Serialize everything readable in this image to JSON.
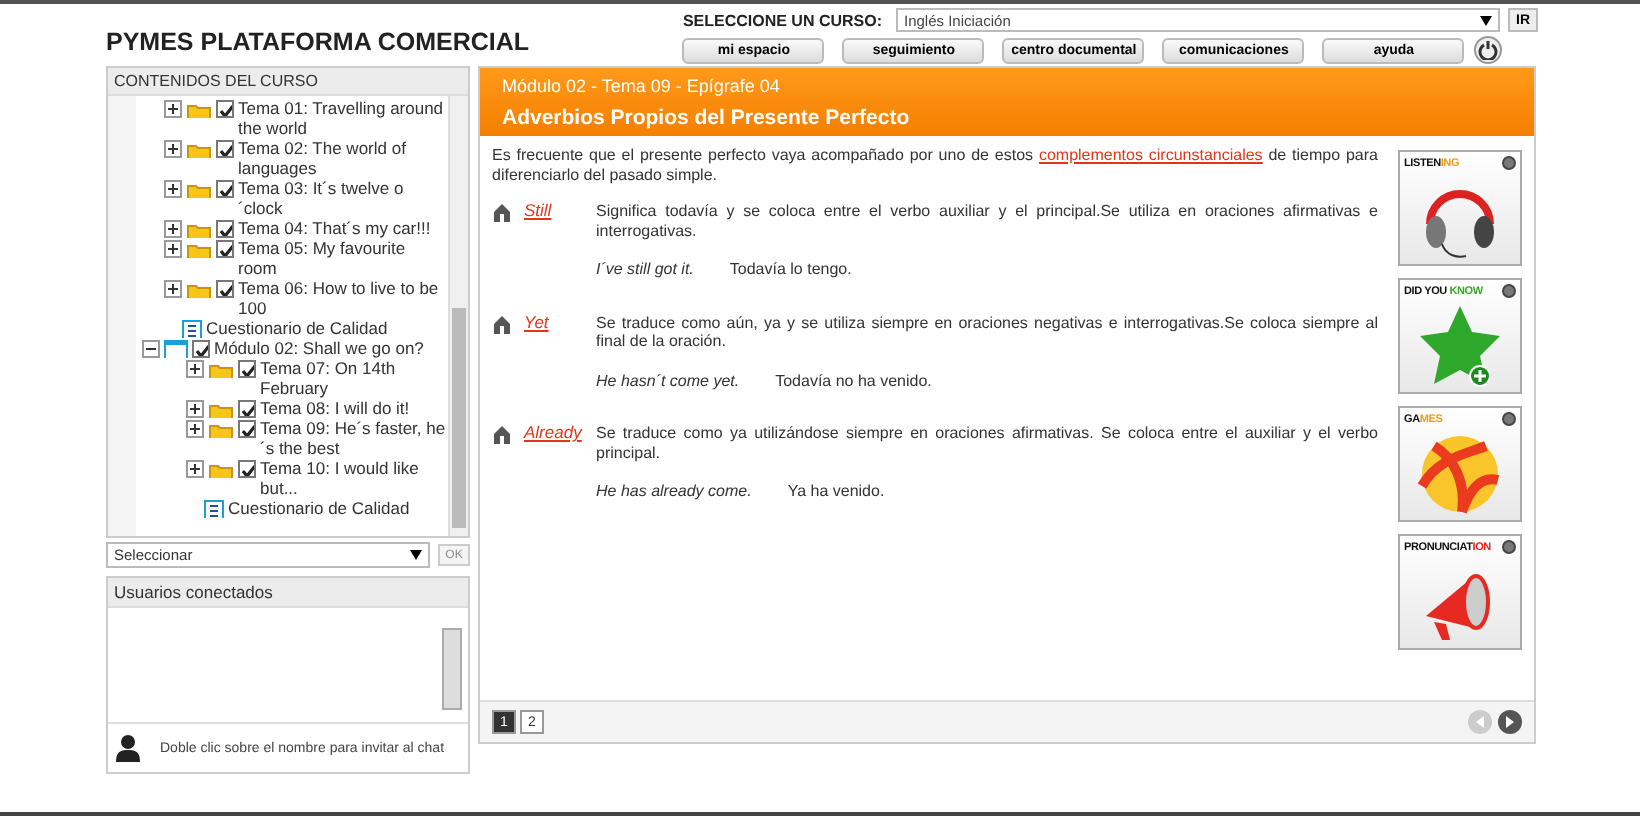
{
  "header": {
    "title": "PYMES PLATAFORMA COMERCIAL",
    "course_label": "SELECCIONE UN CURSO:",
    "course_value": "Inglés Iniciación",
    "go_button": "IR",
    "nav": [
      "mi espacio",
      "seguimiento",
      "centro documental",
      "comunicaciones",
      "ayuda"
    ]
  },
  "contents": {
    "title": "CONTENIDOS DEL CURSO",
    "tree": [
      {
        "kind": "tema",
        "label": "Tema 01: Travelling around the world",
        "checked": true
      },
      {
        "kind": "tema",
        "label": "Tema 02: The world of languages",
        "checked": true
      },
      {
        "kind": "tema",
        "label": "Tema 03: It´s twelve o ´clock",
        "checked": true
      },
      {
        "kind": "tema",
        "label": "Tema 04: That´s my car!!!",
        "checked": true
      },
      {
        "kind": "tema",
        "label": "Tema 05: My favourite room",
        "checked": true
      },
      {
        "kind": "tema",
        "label": "Tema 06: How to live to be 100",
        "checked": true
      },
      {
        "kind": "quiz",
        "label": "Cuestionario de Calidad"
      },
      {
        "kind": "module",
        "label": "Módulo 02: Shall we go on?",
        "checked": true,
        "expanded": true,
        "children": [
          {
            "kind": "tema",
            "label": "Tema 07: On 14th February",
            "checked": true
          },
          {
            "kind": "tema",
            "label": "Tema 08: I will do it!",
            "checked": true
          },
          {
            "kind": "tema",
            "label": "Tema 09: He´s faster, he´s the best",
            "checked": true
          },
          {
            "kind": "tema",
            "label": "Tema 10: I would like but...",
            "checked": true
          },
          {
            "kind": "quiz",
            "label": "Cuestionario de Calidad"
          }
        ]
      }
    ],
    "select_value": "Seleccionar",
    "ok_button": "OK",
    "ok_disabled": true
  },
  "users": {
    "title": "Usuarios conectados",
    "hint": "Doble clic sobre el nombre para invitar al chat"
  },
  "lesson": {
    "breadcrumb": "Módulo 02 - Tema 09 - Epígrafe 04",
    "title": "Adverbios Propios del Presente Perfecto",
    "intro_before": "Es frecuente que el presente perfecto vaya acompañado por uno de estos ",
    "intro_link": "complementos circunstanciales",
    "intro_after": " de tiempo para diferenciarlo del pasado simple.",
    "entries": [
      {
        "word": "Still",
        "text": "Significa todavía y se coloca entre el verbo auxiliar y el principal.Se utiliza en oraciones afirmativas e interrogativas.",
        "example": "I´ve still got it.",
        "translation": "Todavía lo tengo."
      },
      {
        "word": "Yet",
        "text": "Se traduce como aún, ya y se utiliza siempre en oraciones negativas e interrogativas.Se coloca siempre al final de la oración.",
        "example": "He hasn´t come yet.",
        "translation": "Todavía no ha venido."
      },
      {
        "word": "Already",
        "text": "Se traduce como ya utilizándose siempre en oraciones afirmativas. Se coloca entre el auxiliar y el verbo principal.",
        "example": "He has already come.",
        "translation": "Ya ha venido."
      }
    ],
    "widgets": [
      {
        "kind": "headphones",
        "title": "LISTEN",
        "accent": "ING",
        "color": "#f39a1e"
      },
      {
        "kind": "star",
        "title": "DID YOU ",
        "accent": "KNOW",
        "color": "#3aa829"
      },
      {
        "kind": "ball",
        "title": "GA",
        "accent": "MES",
        "color": "#f39a1e"
      },
      {
        "kind": "megaphone",
        "title": "PRONUNCIAT",
        "accent": "ION",
        "color": "#e5231f"
      }
    ],
    "pages": [
      {
        "label": "1",
        "selected": true
      },
      {
        "label": "2",
        "selected": false
      }
    ],
    "prev_disabled": true,
    "next_disabled": false
  }
}
